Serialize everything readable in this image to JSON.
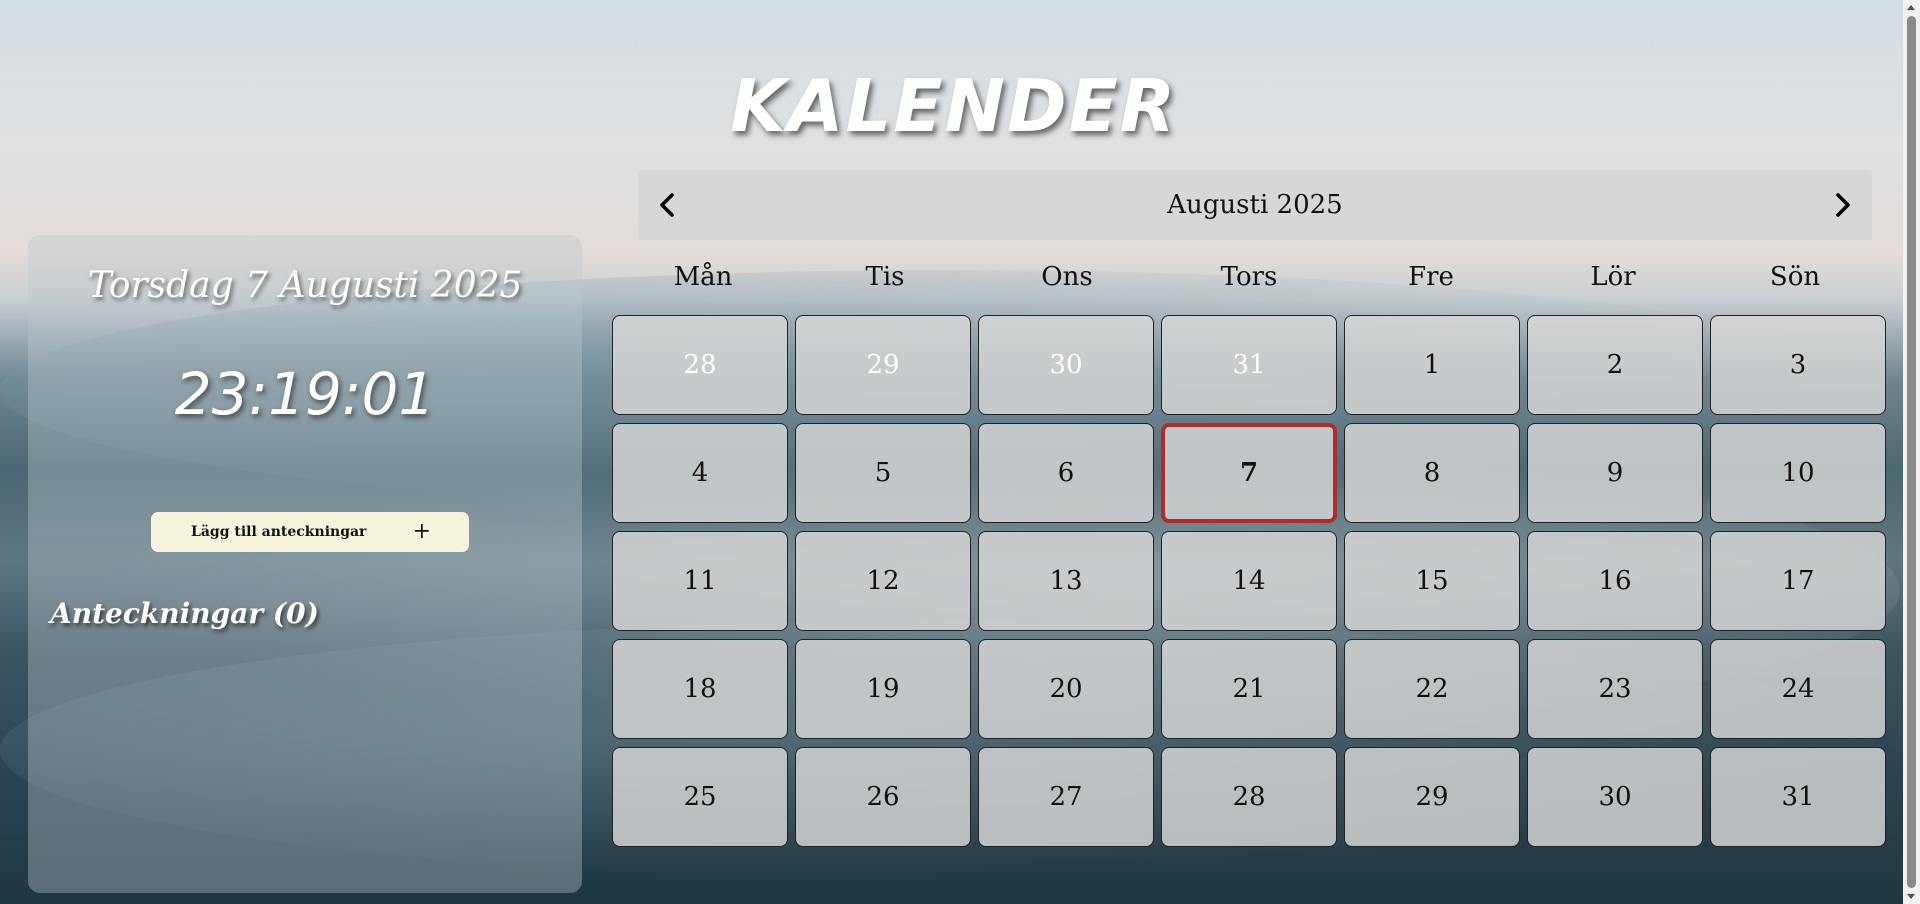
{
  "page": {
    "title": "KALENDER"
  },
  "sidebar": {
    "date_text": "Torsdag 7 Augusti 2025",
    "clock": "23:19:01",
    "add_note_label": "Lägg till anteckningar",
    "add_note_icon": "plus-icon",
    "notes_heading": "Anteckningar (0)"
  },
  "calendar": {
    "month_label": "Augusti 2025",
    "prev_icon": "chevron-left-icon",
    "next_icon": "chevron-right-icon",
    "weekdays": [
      "Mån",
      "Tis",
      "Ons",
      "Tors",
      "Fre",
      "Lör",
      "Sön"
    ],
    "days": [
      {
        "label": "28",
        "other_month": true
      },
      {
        "label": "29",
        "other_month": true
      },
      {
        "label": "30",
        "other_month": true
      },
      {
        "label": "31",
        "other_month": true
      },
      {
        "label": "1"
      },
      {
        "label": "2"
      },
      {
        "label": "3"
      },
      {
        "label": "4"
      },
      {
        "label": "5"
      },
      {
        "label": "6"
      },
      {
        "label": "7",
        "today": true
      },
      {
        "label": "8"
      },
      {
        "label": "9"
      },
      {
        "label": "10"
      },
      {
        "label": "11"
      },
      {
        "label": "12"
      },
      {
        "label": "13"
      },
      {
        "label": "14"
      },
      {
        "label": "15"
      },
      {
        "label": "16"
      },
      {
        "label": "17"
      },
      {
        "label": "18"
      },
      {
        "label": "19"
      },
      {
        "label": "20"
      },
      {
        "label": "21"
      },
      {
        "label": "22"
      },
      {
        "label": "23"
      },
      {
        "label": "24"
      },
      {
        "label": "25"
      },
      {
        "label": "26"
      },
      {
        "label": "27"
      },
      {
        "label": "28"
      },
      {
        "label": "29"
      },
      {
        "label": "30"
      },
      {
        "label": "31"
      }
    ],
    "today_border_color": "#b22a2a"
  }
}
